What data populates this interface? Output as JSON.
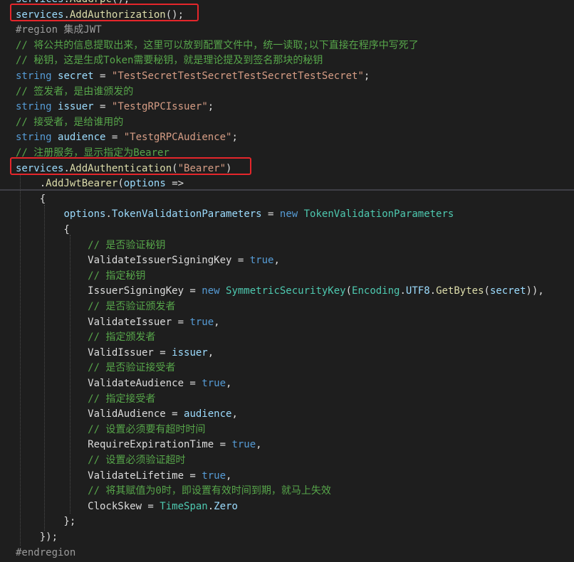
{
  "editor": {
    "lines": [
      {
        "tokens": [
          {
            "t": "services",
            "c": "id"
          },
          {
            "t": ".",
            "c": "plain"
          },
          {
            "t": "AddGrpc",
            "c": "method"
          },
          {
            "t": "();",
            "c": "plain"
          }
        ]
      },
      {
        "tokens": [
          {
            "t": "services",
            "c": "id"
          },
          {
            "t": ".",
            "c": "plain"
          },
          {
            "t": "AddAuthorization",
            "c": "method"
          },
          {
            "t": "();",
            "c": "plain"
          }
        ]
      },
      {
        "tokens": [
          {
            "t": "#region 集成JWT",
            "c": "pre"
          }
        ]
      },
      {
        "tokens": [
          {
            "t": "// 将公共的信息提取出来，这里可以放到配置文件中，统一读取;以下直接在程序中写死了",
            "c": "comment"
          }
        ]
      },
      {
        "tokens": [
          {
            "t": "// 秘钥，这是生成Token需要秘钥，就是理论提及到签名那块的秘钥",
            "c": "comment"
          }
        ]
      },
      {
        "tokens": [
          {
            "t": "string ",
            "c": "kw"
          },
          {
            "t": "secret",
            "c": "id"
          },
          {
            "t": " = ",
            "c": "plain"
          },
          {
            "t": "\"TestSecretTestSecretTestSecretTestSecret\"",
            "c": "str"
          },
          {
            "t": ";",
            "c": "plain"
          }
        ]
      },
      {
        "tokens": [
          {
            "t": "// 签发者，是由谁颁发的",
            "c": "comment"
          }
        ]
      },
      {
        "tokens": [
          {
            "t": "string ",
            "c": "kw"
          },
          {
            "t": "issuer",
            "c": "id"
          },
          {
            "t": " = ",
            "c": "plain"
          },
          {
            "t": "\"TestgRPCIssuer\"",
            "c": "str"
          },
          {
            "t": ";",
            "c": "plain"
          }
        ]
      },
      {
        "tokens": [
          {
            "t": "// 接受者，是给谁用的",
            "c": "comment"
          }
        ]
      },
      {
        "tokens": [
          {
            "t": "string ",
            "c": "kw"
          },
          {
            "t": "audience",
            "c": "id"
          },
          {
            "t": " = ",
            "c": "plain"
          },
          {
            "t": "\"TestgRPCAudience\"",
            "c": "str"
          },
          {
            "t": ";",
            "c": "plain"
          }
        ]
      },
      {
        "tokens": [
          {
            "t": "// 注册服务，显示指定为Bearer",
            "c": "comment"
          }
        ]
      },
      {
        "tokens": [
          {
            "t": "services",
            "c": "id"
          },
          {
            "t": ".",
            "c": "plain"
          },
          {
            "t": "AddAuthentication",
            "c": "method"
          },
          {
            "t": "(",
            "c": "plain"
          },
          {
            "t": "\"Bearer\"",
            "c": "str"
          },
          {
            "t": ")",
            "c": "plain"
          }
        ]
      },
      {
        "tokens": [
          {
            "t": "    .",
            "c": "plain"
          },
          {
            "t": "AddJwtBearer",
            "c": "method"
          },
          {
            "t": "(",
            "c": "plain"
          },
          {
            "t": "options",
            "c": "id"
          },
          {
            "t": " =>",
            "c": "plain"
          }
        ]
      },
      {
        "tokens": [
          {
            "t": "    {",
            "c": "plain"
          }
        ]
      },
      {
        "tokens": [
          {
            "t": "        ",
            "c": "plain"
          },
          {
            "t": "options",
            "c": "id"
          },
          {
            "t": ".",
            "c": "plain"
          },
          {
            "t": "TokenValidationParameters",
            "c": "id"
          },
          {
            "t": " = ",
            "c": "plain"
          },
          {
            "t": "new ",
            "c": "kw"
          },
          {
            "t": "TokenValidationParameters",
            "c": "type"
          }
        ]
      },
      {
        "tokens": [
          {
            "t": "        {",
            "c": "plain"
          }
        ]
      },
      {
        "tokens": [
          {
            "t": "            // 是否验证秘钥",
            "c": "comment"
          }
        ]
      },
      {
        "tokens": [
          {
            "t": "            ValidateIssuerSigningKey = ",
            "c": "plain"
          },
          {
            "t": "true",
            "c": "kw"
          },
          {
            "t": ",",
            "c": "plain"
          }
        ]
      },
      {
        "tokens": [
          {
            "t": "            // 指定秘钥",
            "c": "comment"
          }
        ]
      },
      {
        "tokens": [
          {
            "t": "            IssuerSigningKey = ",
            "c": "plain"
          },
          {
            "t": "new ",
            "c": "kw"
          },
          {
            "t": "SymmetricSecurityKey",
            "c": "type"
          },
          {
            "t": "(",
            "c": "plain"
          },
          {
            "t": "Encoding",
            "c": "type"
          },
          {
            "t": ".",
            "c": "plain"
          },
          {
            "t": "UTF8",
            "c": "id"
          },
          {
            "t": ".",
            "c": "plain"
          },
          {
            "t": "GetBytes",
            "c": "method"
          },
          {
            "t": "(",
            "c": "plain"
          },
          {
            "t": "secret",
            "c": "id"
          },
          {
            "t": ")),",
            "c": "plain"
          }
        ]
      },
      {
        "tokens": [
          {
            "t": "            // 是否验证颁发者",
            "c": "comment"
          }
        ]
      },
      {
        "tokens": [
          {
            "t": "            ValidateIssuer = ",
            "c": "plain"
          },
          {
            "t": "true",
            "c": "kw"
          },
          {
            "t": ",",
            "c": "plain"
          }
        ]
      },
      {
        "tokens": [
          {
            "t": "            // 指定颁发者",
            "c": "comment"
          }
        ]
      },
      {
        "tokens": [
          {
            "t": "            ValidIssuer = ",
            "c": "plain"
          },
          {
            "t": "issuer",
            "c": "id"
          },
          {
            "t": ",",
            "c": "plain"
          }
        ]
      },
      {
        "tokens": [
          {
            "t": "            // 是否验证接受者",
            "c": "comment"
          }
        ]
      },
      {
        "tokens": [
          {
            "t": "            ValidateAudience = ",
            "c": "plain"
          },
          {
            "t": "true",
            "c": "kw"
          },
          {
            "t": ",",
            "c": "plain"
          }
        ]
      },
      {
        "tokens": [
          {
            "t": "            // 指定接受者",
            "c": "comment"
          }
        ]
      },
      {
        "tokens": [
          {
            "t": "            ValidAudience = ",
            "c": "plain"
          },
          {
            "t": "audience",
            "c": "id"
          },
          {
            "t": ",",
            "c": "plain"
          }
        ]
      },
      {
        "tokens": [
          {
            "t": "            // 设置必须要有超时时间",
            "c": "comment"
          }
        ]
      },
      {
        "tokens": [
          {
            "t": "            RequireExpirationTime = ",
            "c": "plain"
          },
          {
            "t": "true",
            "c": "kw"
          },
          {
            "t": ",",
            "c": "plain"
          }
        ]
      },
      {
        "tokens": [
          {
            "t": "            // 设置必须验证超时",
            "c": "comment"
          }
        ]
      },
      {
        "tokens": [
          {
            "t": "            ValidateLifetime = ",
            "c": "plain"
          },
          {
            "t": "true",
            "c": "kw"
          },
          {
            "t": ",",
            "c": "plain"
          }
        ]
      },
      {
        "tokens": [
          {
            "t": "            // 将其赋值为0时，即设置有效时间到期，就马上失效",
            "c": "comment"
          }
        ]
      },
      {
        "tokens": [
          {
            "t": "            ClockSkew = ",
            "c": "plain"
          },
          {
            "t": "TimeSpan",
            "c": "type"
          },
          {
            "t": ".",
            "c": "plain"
          },
          {
            "t": "Zero",
            "c": "id"
          }
        ]
      },
      {
        "tokens": [
          {
            "t": "        };",
            "c": "plain"
          }
        ]
      },
      {
        "tokens": [
          {
            "t": "    });",
            "c": "plain"
          }
        ]
      },
      {
        "tokens": [
          {
            "t": "#endregion",
            "c": "pre"
          }
        ]
      }
    ]
  },
  "colors": {
    "background": "#1e1e1e",
    "highlight_border": "#e5262b"
  }
}
